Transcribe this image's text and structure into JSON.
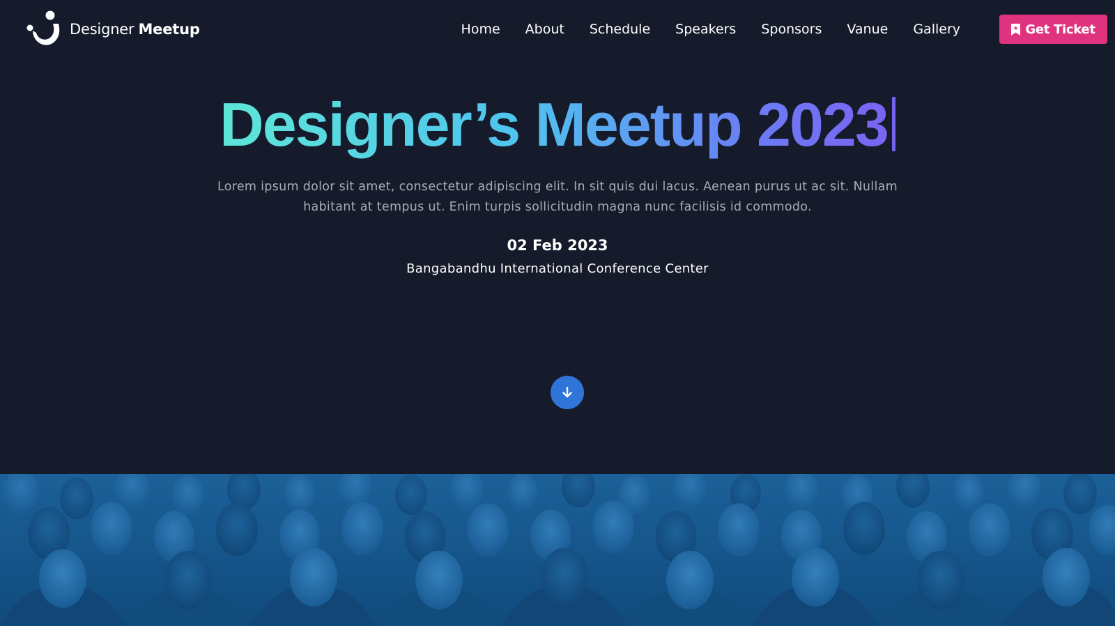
{
  "header": {
    "logo": {
      "light_text": "Designer",
      "bold_text": "Meetup",
      "icon": "smile-person-logo-icon"
    },
    "nav": [
      {
        "label": "Home"
      },
      {
        "label": "About"
      },
      {
        "label": "Schedule"
      },
      {
        "label": "Speakers"
      },
      {
        "label": "Sponsors"
      },
      {
        "label": "Vanue"
      },
      {
        "label": "Gallery"
      }
    ],
    "ticket_button": {
      "label": "Get Ticket",
      "icon": "bookmark-icon"
    }
  },
  "hero": {
    "title": "Designer’s Meetup 2023",
    "description": "Lorem ipsum dolor sit amet, consectetur adipiscing elit. In sit quis dui lacus. Aenean purus ut ac sit. Nullam habitant at tempus ut. Enim turpis sollicitudin magna nunc facilisis id commodo.",
    "date": "02 Feb 2023",
    "venue": "Bangabandhu International Conference Center",
    "scroll_icon": "arrow-down-icon"
  },
  "crowd_image": {
    "icon": "crowd-photo"
  },
  "colors": {
    "background": "#161b2b",
    "accent_pink": "#e0337f",
    "accent_blue": "#2f74d9",
    "gradient_start": "#5ee6d8",
    "gradient_end": "#7a64f2",
    "photo_tint": "#1c5f95"
  }
}
